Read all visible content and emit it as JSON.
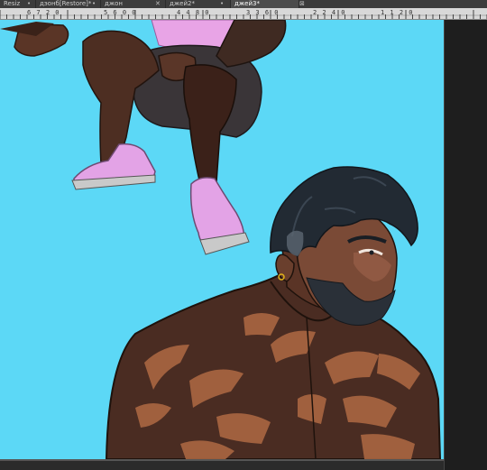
{
  "tabs": [
    {
      "label": "Resiz"
    },
    {
      "label": "дэонб[Restore]*"
    },
    {
      "label": "джон"
    },
    {
      "label": "джей2*"
    },
    {
      "label": "джей3*"
    }
  ],
  "ruler": {
    "labels": [
      "6 7 2 0",
      "5 6 0 0",
      "4 4 8 0",
      "3 3 6 0",
      "2 2 4 0",
      "1 1 2 0"
    ]
  },
  "colors": {
    "canvas_bg": "#5cd8f6",
    "tab_active": "#4c4c4c",
    "shoe": "#e3a3e6",
    "skin": "#6a3f2d",
    "tattoo": "#b06a43",
    "hair": "#222a33"
  },
  "icons": {
    "tab_close": "close-icon"
  }
}
